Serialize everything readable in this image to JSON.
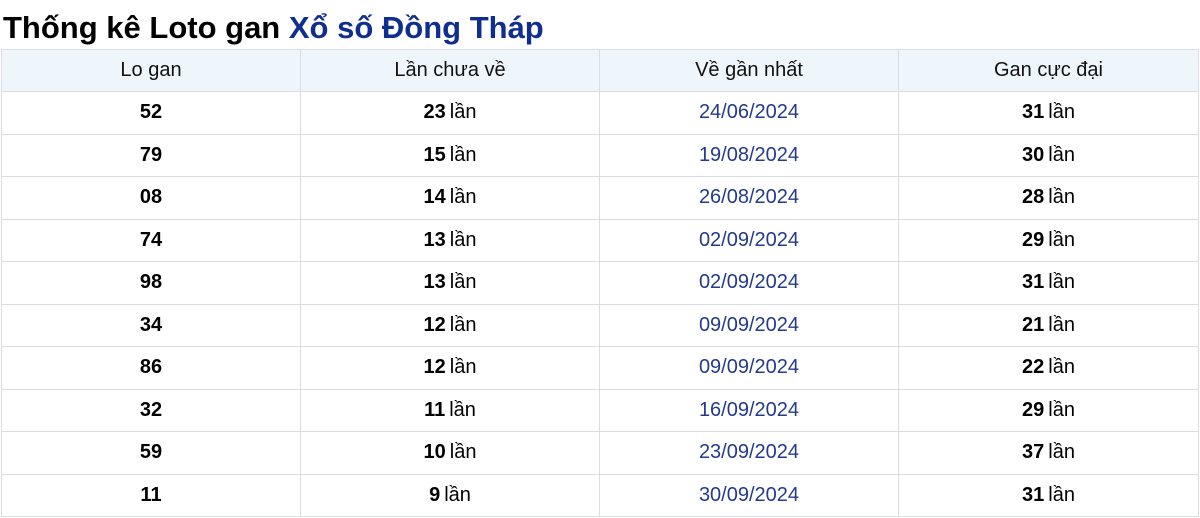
{
  "heading": {
    "prefix": "Thống kê Loto gan",
    "accent": "Xổ số Đồng Tháp"
  },
  "colors": {
    "accent": "#0f2e8f",
    "date_text": "#243a8c",
    "header_background": "#eef6fc",
    "border": "#d9dde3"
  },
  "table": {
    "columns": [
      "Lo gan",
      "Lần chưa về",
      "Về gần nhất",
      "Gan cực đại"
    ],
    "unit": "lần",
    "rows": [
      {
        "lo": "52",
        "chua_ve": "23",
        "gan_nhat": "24/06/2024",
        "cuc_dai": "31"
      },
      {
        "lo": "79",
        "chua_ve": "15",
        "gan_nhat": "19/08/2024",
        "cuc_dai": "30"
      },
      {
        "lo": "08",
        "chua_ve": "14",
        "gan_nhat": "26/08/2024",
        "cuc_dai": "28"
      },
      {
        "lo": "74",
        "chua_ve": "13",
        "gan_nhat": "02/09/2024",
        "cuc_dai": "29"
      },
      {
        "lo": "98",
        "chua_ve": "13",
        "gan_nhat": "02/09/2024",
        "cuc_dai": "31"
      },
      {
        "lo": "34",
        "chua_ve": "12",
        "gan_nhat": "09/09/2024",
        "cuc_dai": "21"
      },
      {
        "lo": "86",
        "chua_ve": "12",
        "gan_nhat": "09/09/2024",
        "cuc_dai": "22"
      },
      {
        "lo": "32",
        "chua_ve": "11",
        "gan_nhat": "16/09/2024",
        "cuc_dai": "29"
      },
      {
        "lo": "59",
        "chua_ve": "10",
        "gan_nhat": "23/09/2024",
        "cuc_dai": "37"
      },
      {
        "lo": "11",
        "chua_ve": "9",
        "gan_nhat": "30/09/2024",
        "cuc_dai": "31"
      }
    ]
  }
}
